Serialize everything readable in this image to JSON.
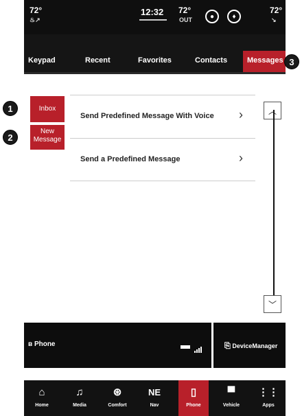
{
  "status": {
    "left_temp": "72°",
    "time": "12:32",
    "outside_temp": "72°",
    "outside_label": "OUT",
    "right_temp": "72°"
  },
  "tabs": [
    {
      "label": "Keypad"
    },
    {
      "label": "Recent"
    },
    {
      "label": "Favorites"
    },
    {
      "label": "Contacts"
    },
    {
      "label": "Messages"
    }
  ],
  "side_buttons": {
    "inbox": "Inbox",
    "new_message": "New Message"
  },
  "list": [
    {
      "label": "Send Predefined Message With Voice"
    },
    {
      "label": "Send a Predefined Message"
    }
  ],
  "phone_bar": {
    "phone_label": "Phone",
    "device_manager_label": "DeviceManager"
  },
  "nav": [
    {
      "label": "Home",
      "icon": "home-icon"
    },
    {
      "label": "Media",
      "icon": "music-note-icon"
    },
    {
      "label": "Comfort",
      "icon": "comfort-icon"
    },
    {
      "label": "Nav",
      "icon": "compass-icon",
      "heading": "NE"
    },
    {
      "label": "Phone",
      "icon": "phone-icon"
    },
    {
      "label": "Vehicle",
      "icon": "car-icon"
    },
    {
      "label": "Apps",
      "icon": "apps-grid-icon"
    }
  ],
  "callouts": [
    "1",
    "2",
    "3"
  ],
  "colors": {
    "accent": "#b8202a",
    "background": "#111111"
  }
}
